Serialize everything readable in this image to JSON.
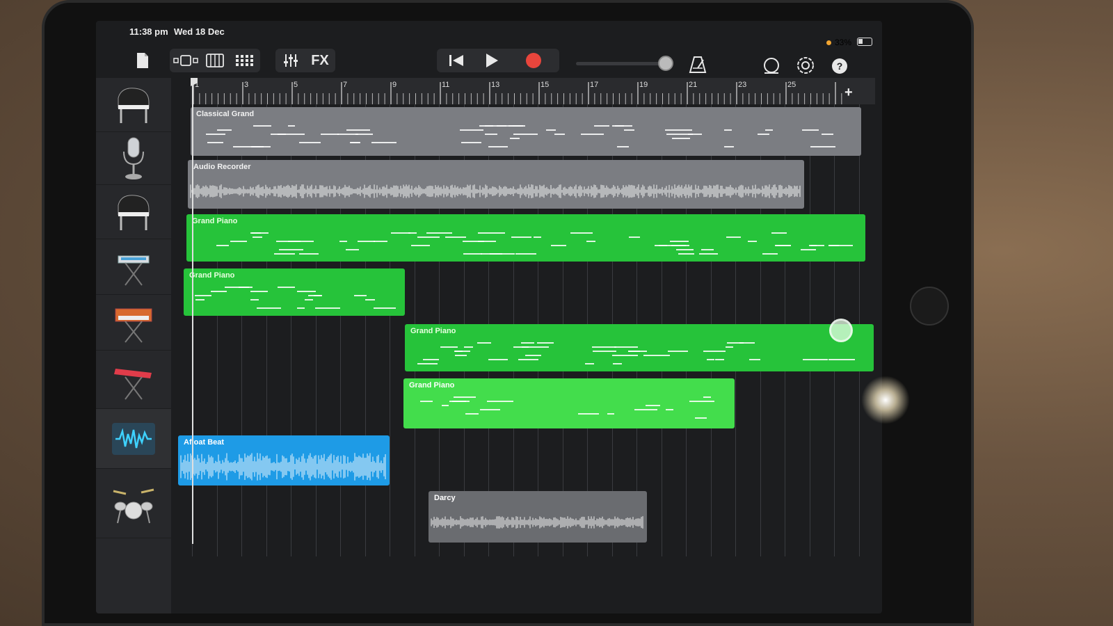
{
  "status": {
    "time": "11:38 pm",
    "date": "Wed 18 Dec",
    "battery": "33%"
  },
  "toolbar": {
    "fx_label": "FX",
    "icons": [
      "document-icon",
      "tracks-view-icon",
      "keyboard-icon",
      "grid-icon",
      "mixer-icon",
      "rewind-icon",
      "play-icon",
      "record-icon",
      "metronome-icon",
      "loop-browser-icon",
      "settings-icon",
      "help-icon"
    ],
    "help_label": "?",
    "record_color": "#e8453c"
  },
  "ruler": {
    "bars": [
      "1",
      "3",
      "5",
      "7",
      "9",
      "11",
      "13",
      "15",
      "17",
      "19",
      "21",
      "23",
      "25"
    ],
    "add_label": "+"
  },
  "tracks": [
    {
      "instrument": "grand-piano-icon"
    },
    {
      "instrument": "microphone-icon"
    },
    {
      "instrument": "grand-piano-icon"
    },
    {
      "instrument": "synth-keyboard-icon"
    },
    {
      "instrument": "orange-synth-icon"
    },
    {
      "instrument": "red-keyboard-icon"
    },
    {
      "instrument": "waveform-icon"
    },
    {
      "instrument": "drum-kit-icon"
    }
  ],
  "add_track_label": "+",
  "regions": [
    {
      "name": "Classical Grand",
      "color": "#7b7d82"
    },
    {
      "name": "Audio Recorder",
      "color": "#7b7d82"
    },
    {
      "name": "Grand Piano",
      "color": "#26c33a"
    },
    {
      "name": "Grand Piano",
      "color": "#26c33a"
    },
    {
      "name": "Grand Piano",
      "color": "#26c33a"
    },
    {
      "name": "Grand Piano",
      "color": "#43dd4c"
    },
    {
      "name": "Afloat Beat",
      "color": "#1e9be6"
    },
    {
      "name": "Darcy",
      "color": "#6a6c70"
    }
  ]
}
